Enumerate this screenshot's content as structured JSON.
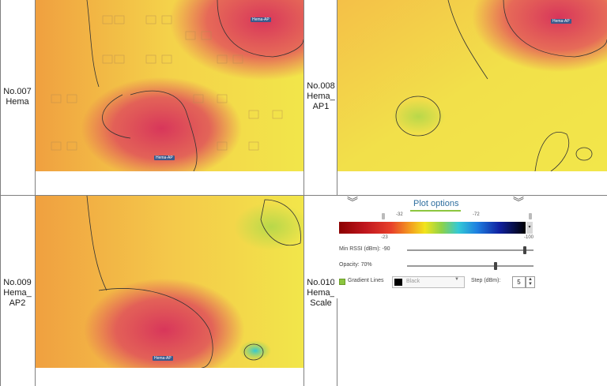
{
  "cells": [
    {
      "label_line1": "No.007",
      "label_line2": "Hema",
      "label_line3": ""
    },
    {
      "label_line1": "No.008",
      "label_line2": "Hema_",
      "label_line3": "AP1"
    },
    {
      "label_line1": "No.009",
      "label_line2": "Hema_",
      "label_line3": "AP2"
    },
    {
      "label_line1": "No.010",
      "label_line2": "Hema_",
      "label_line3": "Scale"
    }
  ],
  "ap_tag": "Hema-AP",
  "plot_options": {
    "title": "Plot options",
    "ticks_top": [
      "-32",
      "-72"
    ],
    "ticks_bottom": [
      "-23",
      "-100"
    ],
    "min_rssi_label": "Min RSSI (dBm): -90",
    "min_rssi_value": 0.93,
    "opacity_label": "Opacity: 70%",
    "opacity_value": 0.7,
    "gradient_lines_label": "Gradient Lines",
    "gradient_color": "Black",
    "step_label": "Step (dBm):",
    "step_value": "5"
  },
  "colors": {
    "weak": "#f2e64a",
    "mid": "#f0a040",
    "strong": "#d8365a",
    "good": "#b8d84a"
  }
}
